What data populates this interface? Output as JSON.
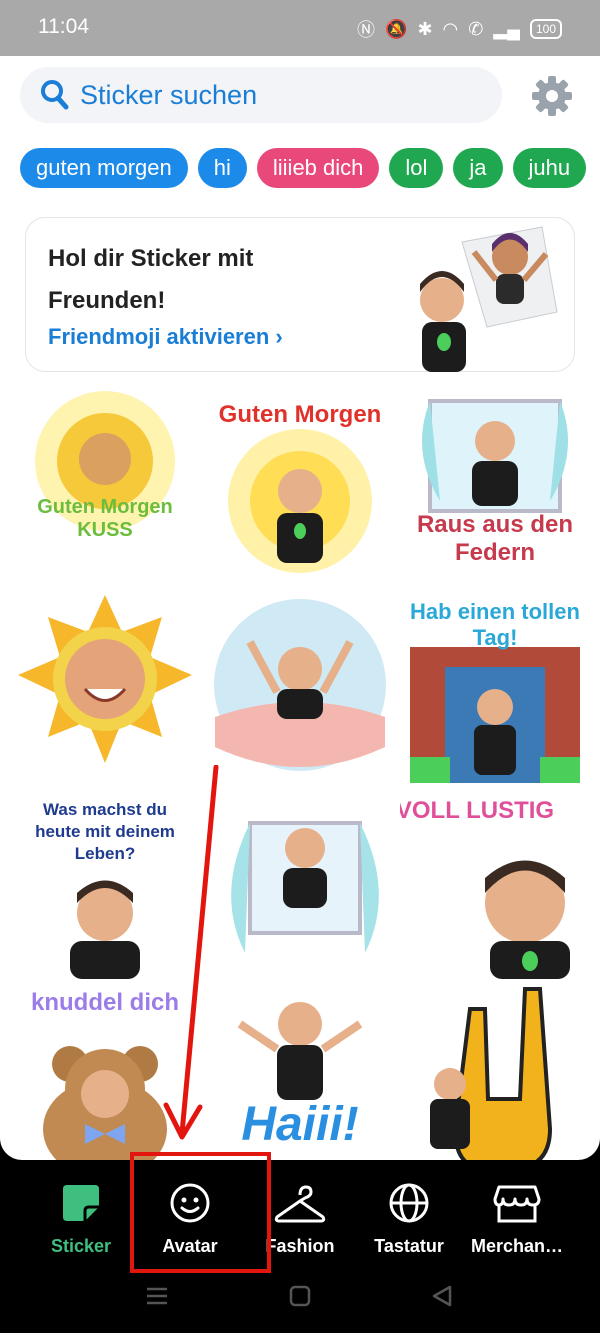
{
  "status_bar": {
    "time": "11:04",
    "battery": "100"
  },
  "search": {
    "placeholder": "Sticker suchen"
  },
  "chips": [
    {
      "label": "guten morgen",
      "color": "#1b8ae8"
    },
    {
      "label": "hi",
      "color": "#1b8ae8"
    },
    {
      "label": "liiieb dich",
      "color": "#e9497a"
    },
    {
      "label": "lol",
      "color": "#1fa84f"
    },
    {
      "label": "ja",
      "color": "#1fa84f"
    },
    {
      "label": "juhu",
      "color": "#1fa84f"
    }
  ],
  "friendmoji_card": {
    "title": "Hol dir Sticker mit Freunden!",
    "link": "Friendmoji aktivieren",
    "link_color": "#1a7dd6"
  },
  "stickers": [
    {
      "name": "sticker-guten-morgen-kuss",
      "text": "Guten Morgen KUSS"
    },
    {
      "name": "sticker-guten-morgen",
      "text": "Guten Morgen"
    },
    {
      "name": "sticker-raus-aus-den-federn",
      "text": "Raus aus den Federn"
    },
    {
      "name": "sticker-sun-face",
      "text": ""
    },
    {
      "name": "sticker-waking-up",
      "text": ""
    },
    {
      "name": "sticker-hab-einen-tollen-tag",
      "text": "Hab einen tollen Tag!"
    },
    {
      "name": "sticker-was-machst-du",
      "text": "Was machst du heute mit deinem Leben?"
    },
    {
      "name": "sticker-window-curtains",
      "text": ""
    },
    {
      "name": "sticker-voll-lustig",
      "text": "VOLL LUSTIG"
    },
    {
      "name": "sticker-knuddel-dich",
      "text": "knuddel dich"
    },
    {
      "name": "sticker-haiii",
      "text": "Haiii!"
    },
    {
      "name": "sticker-rock-hand",
      "text": ""
    }
  ],
  "bottom_nav": {
    "items": [
      {
        "label": "Sticker",
        "icon": "sticker-icon",
        "active": true
      },
      {
        "label": "Avatar",
        "icon": "face-icon",
        "active": false
      },
      {
        "label": "Fashion",
        "icon": "hanger-icon",
        "active": false
      },
      {
        "label": "Tastatur",
        "icon": "globe-icon",
        "active": false
      },
      {
        "label": "Merchan…",
        "icon": "store-icon",
        "active": false
      }
    ],
    "active_color": "#3fbf7f"
  },
  "annotation": {
    "highlight_color": "#e3150f",
    "target": "Avatar"
  }
}
